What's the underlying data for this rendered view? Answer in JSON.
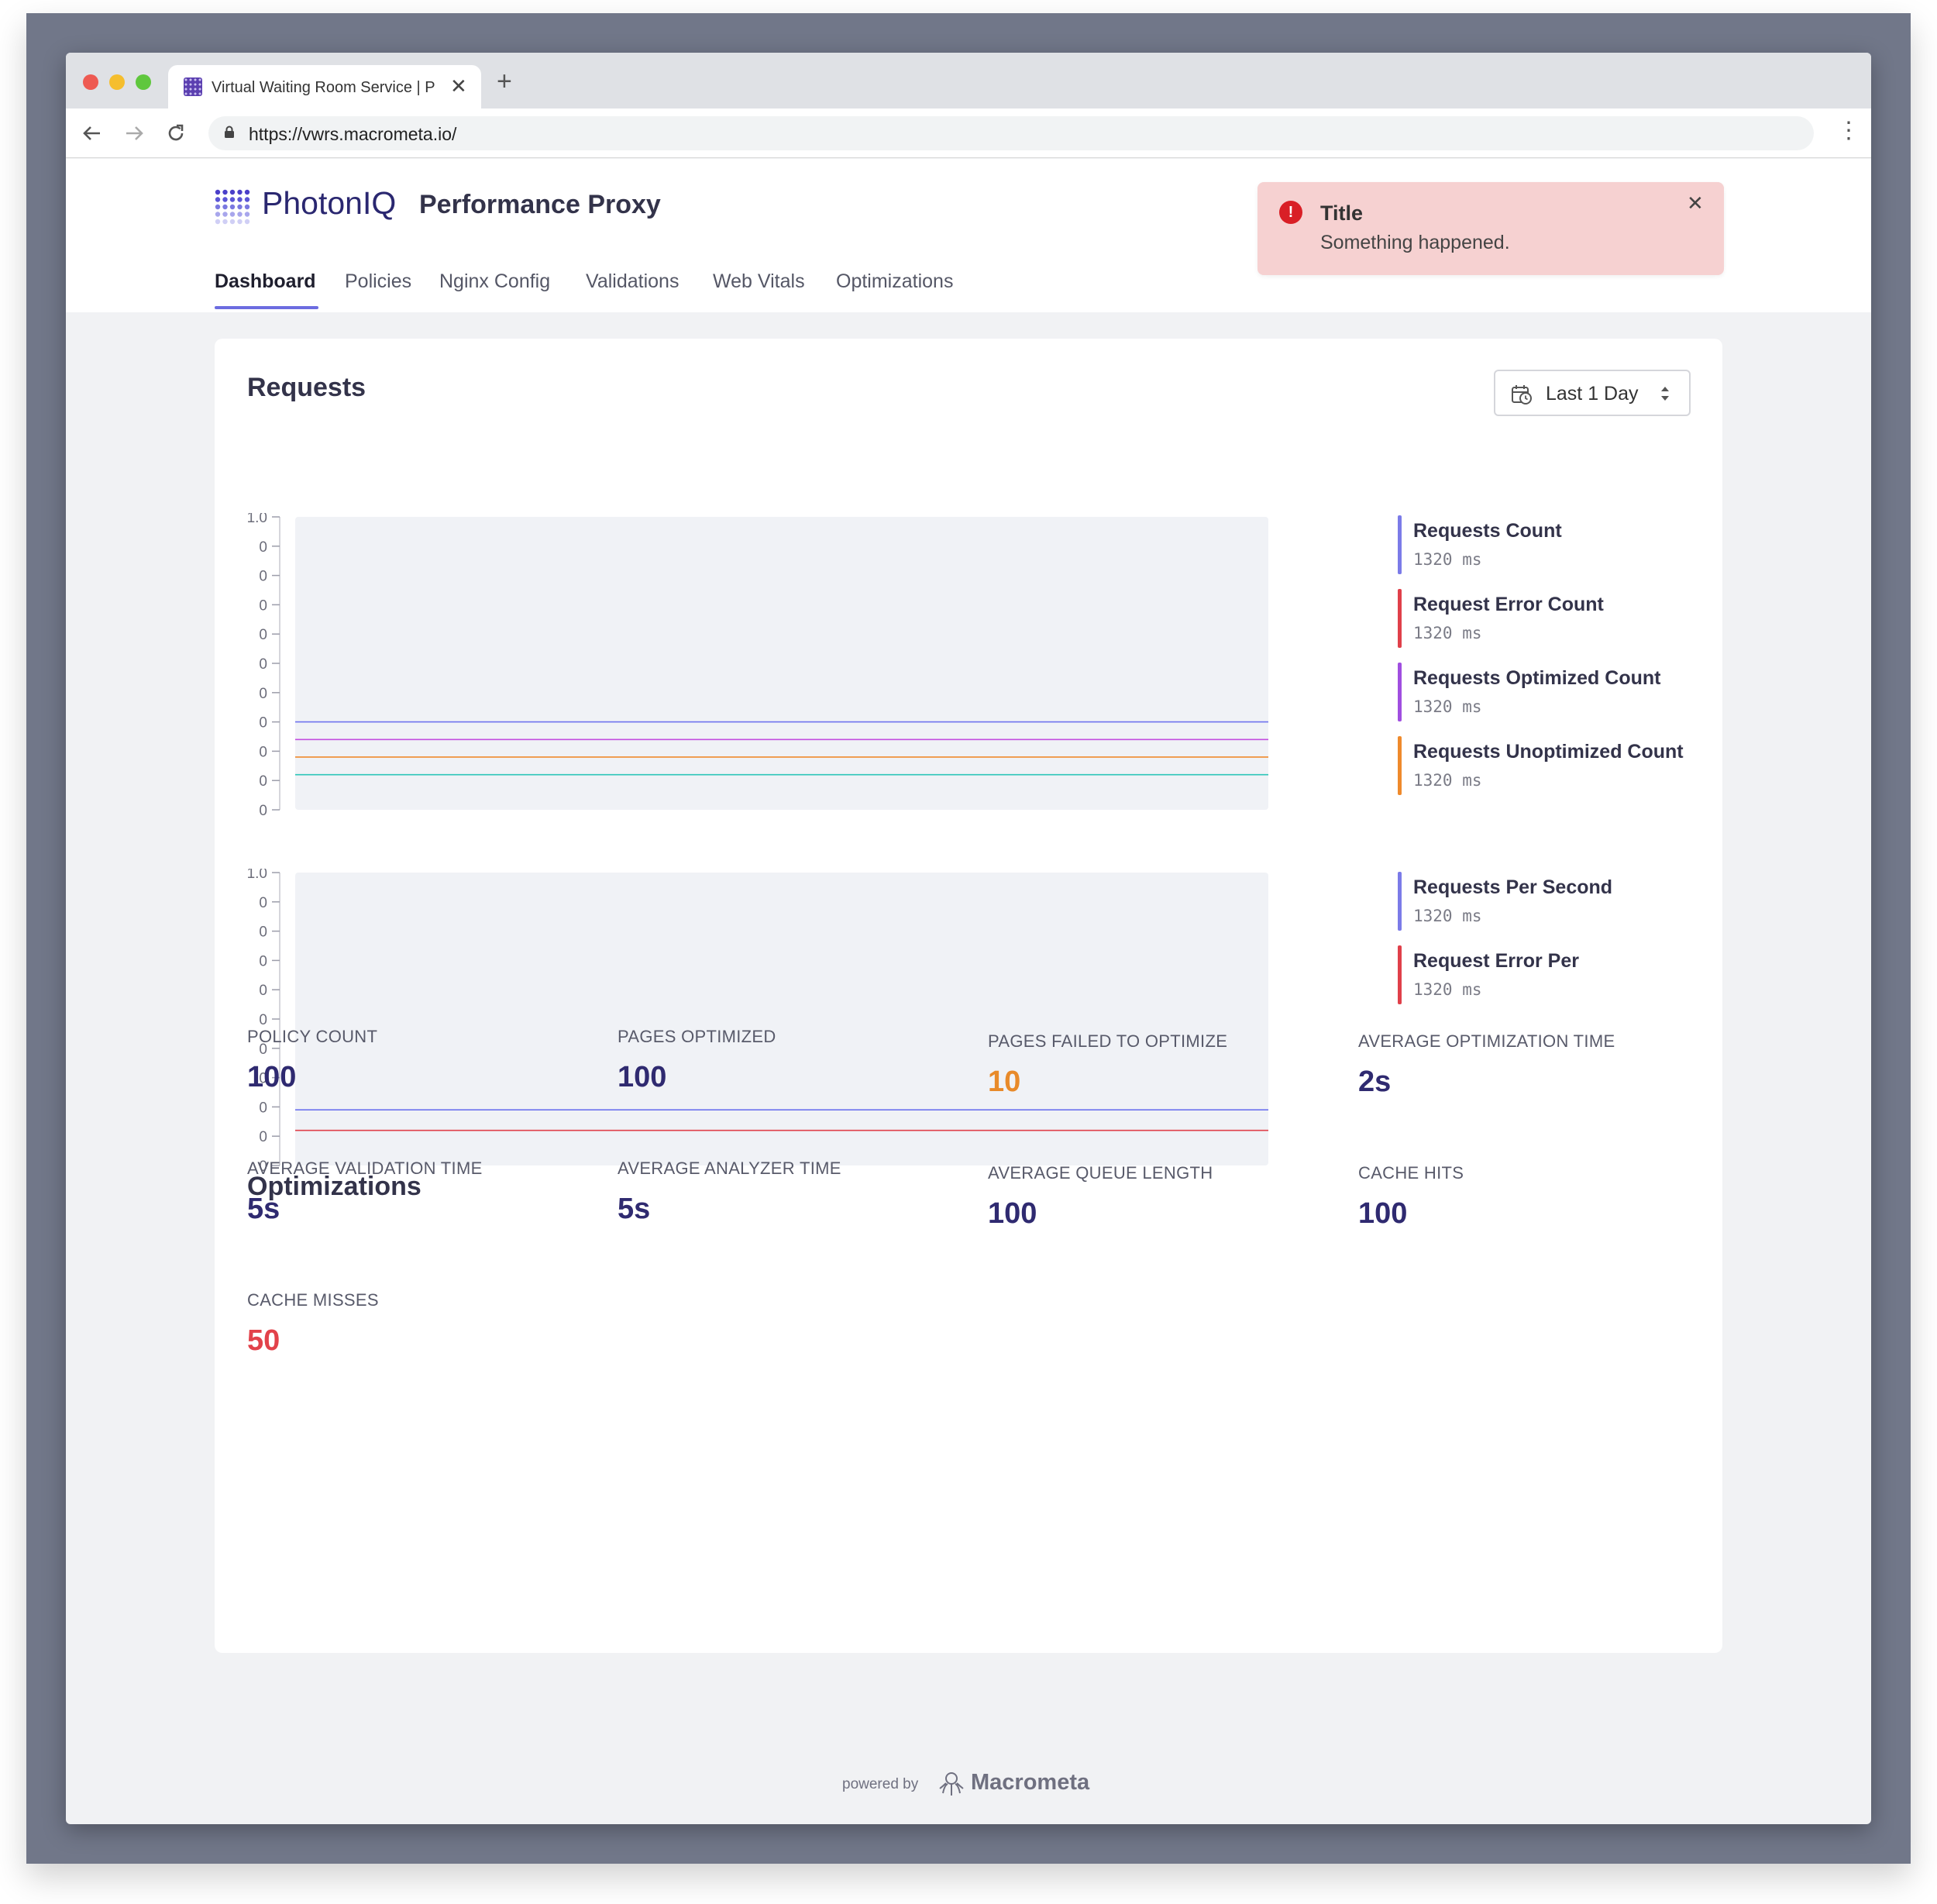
{
  "browser": {
    "tab_title": "Virtual Waiting Room Service | PhotonIQ",
    "url": "https://vwrs.macrometa.io/"
  },
  "app": {
    "logo_text": "PhotonIQ",
    "product_name": "Performance Proxy",
    "nav": [
      "Dashboard",
      "Policies",
      "Nginx Config",
      "Validations",
      "Web Vitals",
      "Optimizations"
    ],
    "active_nav": "Dashboard"
  },
  "toast": {
    "title": "Title",
    "message": "Something happened.",
    "status_color": "#d91f26"
  },
  "requests": {
    "title": "Requests",
    "range": "Last 1 Day",
    "y_ticks": [
      "1.0",
      "0",
      "0",
      "0",
      "0",
      "0",
      "0",
      "0",
      "0",
      "0",
      "0"
    ],
    "legend_top": [
      {
        "name": "Requests Count",
        "value": "1320 ms",
        "color": "#7b7be8"
      },
      {
        "name": "Request Error Count",
        "value": "1320 ms",
        "color": "#e0404a"
      },
      {
        "name": "Requests Optimized Count",
        "value": "1320 ms",
        "color": "#a04fe0"
      },
      {
        "name": "Requests Unoptimized Count",
        "value": "1320 ms",
        "color": "#ef8a2c"
      }
    ],
    "legend_bottom": [
      {
        "name": "Requests Per Second",
        "value": "1320 ms",
        "color": "#7b7be8"
      },
      {
        "name": "Request Error Per",
        "value": "1320 ms",
        "color": "#e0404a"
      }
    ]
  },
  "chart_data": [
    {
      "type": "line",
      "ylim": [
        0,
        1
      ],
      "y_ticks": [
        "1.0",
        "0",
        "0",
        "0",
        "0",
        "0",
        "0",
        "0",
        "0",
        "0",
        "0"
      ],
      "grid": false,
      "legend_placement": "right",
      "series": [
        {
          "name": "Requests Count",
          "color": "#6e73ee",
          "level": 0.3
        },
        {
          "name": "Requests Optimized Count",
          "color": "#c34fe0",
          "level": 0.24
        },
        {
          "name": "Requests Unoptimized Count",
          "color": "#ef8a2c",
          "level": 0.18
        },
        {
          "color": "#2cc6b8",
          "level": 0.12
        }
      ]
    },
    {
      "type": "line",
      "ylim": [
        0,
        1
      ],
      "y_ticks": [
        "1.0",
        "0",
        "0",
        "0",
        "0",
        "0",
        "0",
        "0",
        "0",
        "0",
        "0"
      ],
      "grid": false,
      "legend_placement": "right",
      "series": [
        {
          "name": "Requests Per Second",
          "color": "#6e73ee",
          "level": 0.19
        },
        {
          "name": "Request Error Per",
          "color": "#e0404a",
          "level": 0.12
        }
      ]
    }
  ],
  "optimizations": {
    "title": "Optimizations",
    "metrics": [
      {
        "label": "POLICY COUNT",
        "value": "100",
        "color": "#2f2a70"
      },
      {
        "label": "PAGES OPTIMIZED",
        "value": "100",
        "color": "#2f2a70"
      },
      {
        "label": "PAGES FAILED TO OPTIMIZE",
        "value": "10",
        "color": "#e88a2a"
      },
      {
        "label": "AVERAGE OPTIMIZATION TIME",
        "value": "2s",
        "color": "#2f2a70"
      },
      {
        "label": "AVERAGE VALIDATION TIME",
        "value": "5s",
        "color": "#2f2a70"
      },
      {
        "label": "AVERAGE ANALYZER TIME",
        "value": "5s",
        "color": "#2f2a70"
      },
      {
        "label": "AVERAGE QUEUE LENGTH",
        "value": "100",
        "color": "#2f2a70"
      },
      {
        "label": "CACHE HITS",
        "value": "100",
        "color": "#2f2a70"
      },
      {
        "label": "CACHE MISSES",
        "value": "50",
        "color": "#e2424a"
      }
    ]
  },
  "footer": {
    "powered_by": "powered by",
    "brand": "Macrometa"
  }
}
